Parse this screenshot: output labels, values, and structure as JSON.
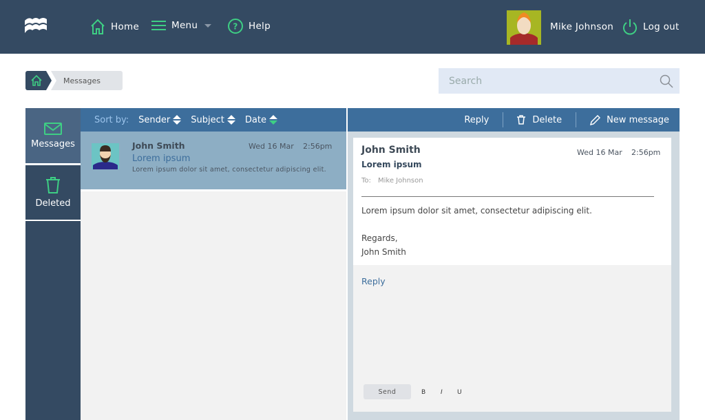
{
  "header": {
    "nav": [
      {
        "label": "Home",
        "icon": "home-icon"
      },
      {
        "label": "Menu",
        "icon": "menu-icon"
      },
      {
        "label": "Help",
        "icon": "help-icon"
      }
    ],
    "user_name": "Mike Johnson",
    "logout_label": "Log out"
  },
  "breadcrumb": {
    "current": "Messages"
  },
  "search": {
    "placeholder": "Search",
    "value": ""
  },
  "sidebar": {
    "items": [
      {
        "label": "Messages",
        "icon": "envelope-icon",
        "active": true
      },
      {
        "label": "Deleted",
        "icon": "trash-icon",
        "active": false
      }
    ]
  },
  "list": {
    "sort_label": "Sort by:",
    "sorters": [
      "Sender",
      "Subject",
      "Date"
    ],
    "messages": [
      {
        "sender": "John Smith",
        "subject": "Lorem ipsum",
        "preview": "Lorem ipsum dolor sit amet, consectetur adipiscing elit.",
        "date": "Wed 16 Mar",
        "time": "2:56pm"
      }
    ]
  },
  "toolbar": {
    "reply": "Reply",
    "delete": "Delete",
    "new_message": "New message"
  },
  "message": {
    "sender": "John Smith",
    "subject": "Lorem ipsum",
    "to_label": "To:",
    "to": "Mike Johnson",
    "date": "Wed 16 Mar",
    "time": "2:56pm",
    "body": "Lorem ipsum dolor sit amet, consectetur adipiscing elit.",
    "closing": "Regards,",
    "signature": "John Smith"
  },
  "reply": {
    "label": "Reply",
    "send": "Send",
    "bold": "B",
    "italic": "I",
    "underline": "U"
  },
  "colors": {
    "header": "#344a62",
    "accent": "#3ecf84",
    "toolbar": "#3d6e9c",
    "selected_row": "#8daec4"
  }
}
